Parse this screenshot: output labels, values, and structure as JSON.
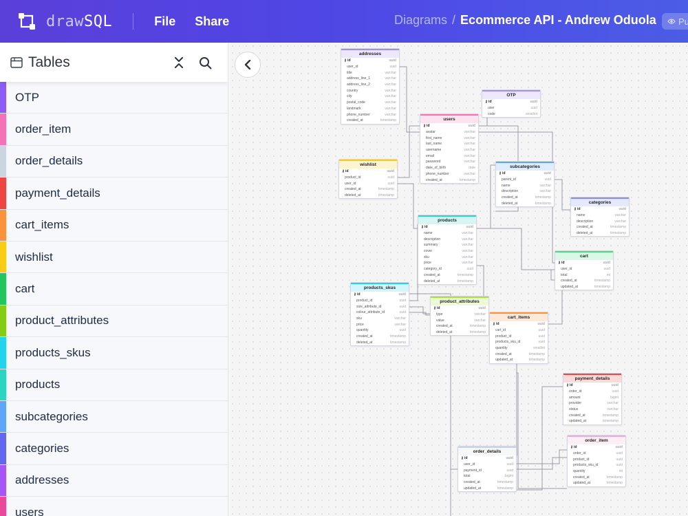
{
  "header": {
    "logo_draw": "draw",
    "logo_sql": "SQL",
    "menu_file": "File",
    "menu_share": "Share",
    "crumb_parent": "Diagrams",
    "crumb_sep": "/",
    "diagram_title": "Ecommerce API - Andrew Oduola",
    "visibility_label": "Pu"
  },
  "sidebar": {
    "title": "Tables",
    "items": [
      {
        "label": "OTP",
        "color": "#8b5cf6"
      },
      {
        "label": "order_item",
        "color": "#f472b6"
      },
      {
        "label": "order_details",
        "color": "#cbd5e1"
      },
      {
        "label": "payment_details",
        "color": "#ef4444"
      },
      {
        "label": "cart_items",
        "color": "#fb923c"
      },
      {
        "label": "wishlist",
        "color": "#facc15"
      },
      {
        "label": "cart",
        "color": "#22c55e"
      },
      {
        "label": "product_attributes",
        "color": "#84cc16"
      },
      {
        "label": "products_skus",
        "color": "#22d3ee"
      },
      {
        "label": "products",
        "color": "#2dd4bf"
      },
      {
        "label": "subcategories",
        "color": "#60a5fa"
      },
      {
        "label": "categories",
        "color": "#6366f1"
      },
      {
        "label": "addresses",
        "color": "#a855f7"
      },
      {
        "label": "users",
        "color": "#ec4899"
      }
    ]
  },
  "diagram": {
    "tables": [
      {
        "id": "addresses",
        "name": "addresses",
        "color": "#a78bfa",
        "cols": [
          [
            "id",
            "uuid"
          ],
          [
            "user_id",
            "uuid"
          ],
          [
            "title",
            "varchar"
          ],
          [
            "address_line_1",
            "varchar"
          ],
          [
            "address_line_2",
            "varchar"
          ],
          [
            "country",
            "varchar"
          ],
          [
            "city",
            "varchar"
          ],
          [
            "postal_code",
            "varchar"
          ],
          [
            "landmark",
            "varchar"
          ],
          [
            "phone_number",
            "varchar"
          ],
          [
            "created_at",
            "timestamp"
          ]
        ]
      },
      {
        "id": "otp",
        "name": "OTP",
        "color": "#a78bfa",
        "cols": [
          [
            "id",
            "uuid"
          ],
          [
            "user",
            "uuid"
          ],
          [
            "code",
            "smallint"
          ]
        ]
      },
      {
        "id": "users",
        "name": "users",
        "color": "#f472b6",
        "cols": [
          [
            "id",
            "uuid"
          ],
          [
            "avatar",
            "varchar"
          ],
          [
            "first_name",
            "varchar"
          ],
          [
            "last_name",
            "varchar"
          ],
          [
            "username",
            "varchar"
          ],
          [
            "email",
            "varchar"
          ],
          [
            "password",
            "varchar"
          ],
          [
            "date_of_birth",
            "date"
          ],
          [
            "phone_number",
            "varchar"
          ],
          [
            "created_at",
            "timestamp"
          ]
        ]
      },
      {
        "id": "wishlist",
        "name": "wishlist",
        "color": "#facc15",
        "cols": [
          [
            "id",
            "uuid"
          ],
          [
            "product_id",
            "uuid"
          ],
          [
            "user_id",
            "uuid"
          ],
          [
            "created_at",
            "timestamp"
          ],
          [
            "deleted_at",
            "timestamp"
          ]
        ]
      },
      {
        "id": "subcategories",
        "name": "subcategories",
        "color": "#60a5fa",
        "cols": [
          [
            "id",
            "uuid"
          ],
          [
            "parent_id",
            "uuid"
          ],
          [
            "name",
            "varchar"
          ],
          [
            "description",
            "varchar"
          ],
          [
            "created_at",
            "timestamp"
          ],
          [
            "deleted_at",
            "timestamp"
          ]
        ]
      },
      {
        "id": "categories",
        "name": "categories",
        "color": "#818cf8",
        "cols": [
          [
            "id",
            "uuid"
          ],
          [
            "name",
            "varchar"
          ],
          [
            "description",
            "varchar"
          ],
          [
            "created_at",
            "timestamp"
          ],
          [
            "deleted_at",
            "timestamp"
          ]
        ]
      },
      {
        "id": "products",
        "name": "products",
        "color": "#2dd4bf",
        "cols": [
          [
            "id",
            "uuid"
          ],
          [
            "name",
            "varchar"
          ],
          [
            "description",
            "varchar"
          ],
          [
            "summary",
            "varchar"
          ],
          [
            "cover",
            "varchar"
          ],
          [
            "sku",
            "varchar"
          ],
          [
            "price",
            "varchar"
          ],
          [
            "category_id",
            "uuid"
          ],
          [
            "created_at",
            "timestamp"
          ],
          [
            "deleted_at",
            "timestamp"
          ]
        ]
      },
      {
        "id": "cart",
        "name": "cart",
        "color": "#4ade80",
        "cols": [
          [
            "id",
            "uuid"
          ],
          [
            "user_id",
            "uuid"
          ],
          [
            "total",
            "int"
          ],
          [
            "created_at",
            "timestamp"
          ],
          [
            "updated_at",
            "timestamp"
          ]
        ]
      },
      {
        "id": "products_skus",
        "name": "products_skus",
        "color": "#22d3ee",
        "cols": [
          [
            "id",
            "uuid"
          ],
          [
            "product_id",
            "uuid"
          ],
          [
            "size_attribute_id",
            "uuid"
          ],
          [
            "colour_attribute_id",
            "uuid"
          ],
          [
            "sku",
            "varchar"
          ],
          [
            "price",
            "varchar"
          ],
          [
            "quantity",
            "uuid"
          ],
          [
            "created_at",
            "timestamp"
          ],
          [
            "deleted_at",
            "timestamp"
          ]
        ]
      },
      {
        "id": "product_attributes",
        "name": "product_attributes",
        "color": "#a3e635",
        "cols": [
          [
            "id",
            "uuid"
          ],
          [
            "type",
            "varchar"
          ],
          [
            "value",
            "varchar"
          ],
          [
            "created_at",
            "timestamp"
          ],
          [
            "deleted_at",
            "timestamp"
          ]
        ]
      },
      {
        "id": "cart_items",
        "name": "cart_items",
        "color": "#fb923c",
        "cols": [
          [
            "id",
            "uuid"
          ],
          [
            "cart_id",
            "uuid"
          ],
          [
            "product_id",
            "uuid"
          ],
          [
            "products_sku_id",
            "uuid"
          ],
          [
            "quantity",
            "smallint"
          ],
          [
            "created_at",
            "timestamp"
          ],
          [
            "updated_at",
            "timestamp"
          ]
        ]
      },
      {
        "id": "payment_details",
        "name": "payment_details",
        "color": "#ef4444",
        "cols": [
          [
            "id",
            "uuid"
          ],
          [
            "order_id",
            "uuid"
          ],
          [
            "amount",
            "bigint"
          ],
          [
            "provider",
            "varchar"
          ],
          [
            "status",
            "varchar"
          ],
          [
            "created_at",
            "timestamp"
          ],
          [
            "updated_at",
            "timestamp"
          ]
        ]
      },
      {
        "id": "order_details",
        "name": "order_details",
        "color": "#cbd5e1",
        "cols": [
          [
            "id",
            "uuid"
          ],
          [
            "user_id",
            "uuid"
          ],
          [
            "payment_id",
            "uuid"
          ],
          [
            "total",
            "bigint"
          ],
          [
            "created_at",
            "timestamp"
          ],
          [
            "updated_at",
            "timestamp"
          ]
        ]
      },
      {
        "id": "order_item",
        "name": "order_item",
        "color": "#f9a8d4",
        "cols": [
          [
            "id",
            "uuid"
          ],
          [
            "order_id",
            "uuid"
          ],
          [
            "product_id",
            "uuid"
          ],
          [
            "products_sku_id",
            "uuid"
          ],
          [
            "quantity",
            "int"
          ],
          [
            "created_at",
            "timestamp"
          ],
          [
            "updated_at",
            "timestamp"
          ]
        ]
      }
    ]
  }
}
